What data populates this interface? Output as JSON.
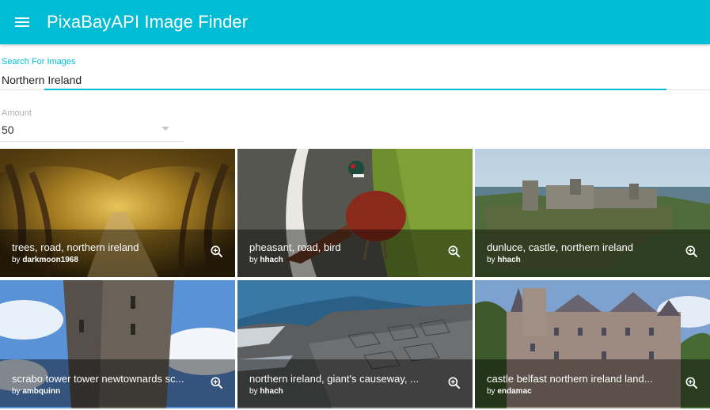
{
  "appbar": {
    "title": "PixaBayAPI Image Finder",
    "menu_icon": "menu-icon",
    "color": "#00bcd4"
  },
  "search": {
    "label": "Search For Images",
    "value": "Northern Ireland",
    "accent_color": "#00bcd4"
  },
  "amount": {
    "label": "Amount",
    "value": "50"
  },
  "images": [
    {
      "title": "trees, road, northern ireland",
      "by_prefix": "by",
      "user": "darkmoon1968",
      "icon": "zoom-in-icon"
    },
    {
      "title": "pheasant, road, bird",
      "by_prefix": "by",
      "user": "hhach",
      "icon": "zoom-in-icon"
    },
    {
      "title": "dunluce, castle, northern ireland",
      "by_prefix": "by",
      "user": "hhach",
      "icon": "zoom-in-icon"
    },
    {
      "title": "scrabo tower tower newtownards sc...",
      "by_prefix": "by",
      "user": "ambquinn",
      "icon": "zoom-in-icon"
    },
    {
      "title": "northern ireland, giant's causeway, ...",
      "by_prefix": "by",
      "user": "hhach",
      "icon": "zoom-in-icon"
    },
    {
      "title": "castle belfast northern ireland land...",
      "by_prefix": "by",
      "user": "endamac",
      "icon": "zoom-in-icon"
    }
  ]
}
